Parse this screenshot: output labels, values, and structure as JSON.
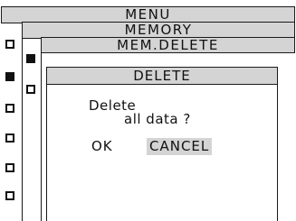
{
  "menu": {
    "title": "MENU"
  },
  "memory": {
    "title": "MEMORY"
  },
  "mem_delete": {
    "title": "MEM.DELETE"
  },
  "dialog": {
    "title": "DELETE",
    "message_line1": "Delete",
    "message_line2": "all data ?",
    "ok_label": "OK",
    "cancel_label": "CANCEL",
    "selected": "CANCEL"
  },
  "colors": {
    "bar_fill": "#d4d4d4",
    "border": "#1a1a1a",
    "selection": "#d4d4d4"
  }
}
